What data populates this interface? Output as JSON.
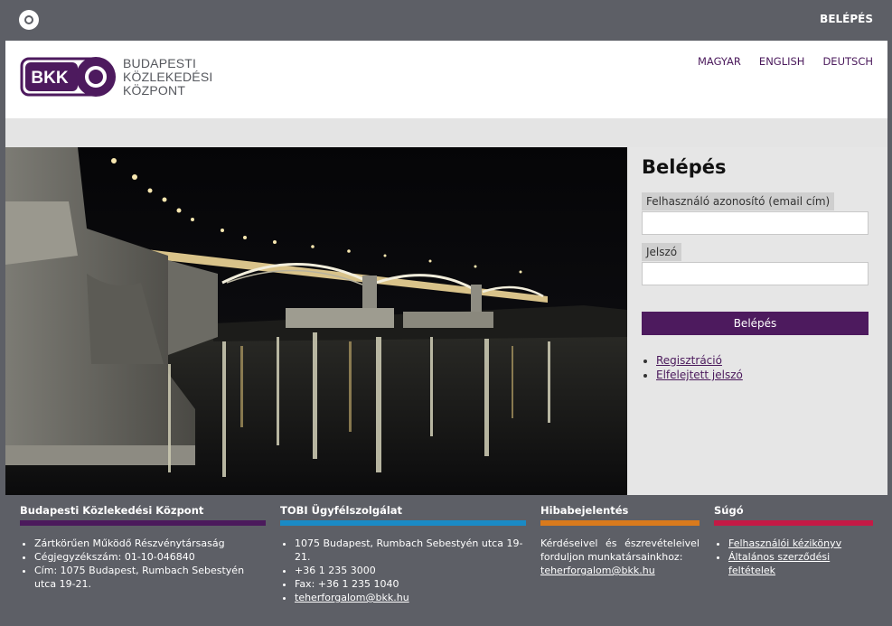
{
  "topbar": {
    "login_label": "BELÉPÉS"
  },
  "header": {
    "logo_text": "BKK",
    "org_name_lines": [
      "BUDAPESTI",
      "KÖZLEKEDÉSI",
      "KÖZPONT"
    ],
    "languages": [
      "MAGYAR",
      "ENGLISH",
      "DEUTSCH"
    ]
  },
  "login": {
    "title": "Belépés",
    "username_label": "Felhasználó azonosító (email cím)",
    "username_value": "",
    "password_label": "Jelszó",
    "password_value": "",
    "submit_label": "Belépés",
    "links": [
      "Regisztráció",
      "Elfelejtett jelszó"
    ]
  },
  "footer": {
    "col1": {
      "title": "Budapesti Közlekedési Központ",
      "bar_color": "#4b1a5c",
      "items": [
        "Zártkörűen Működő Részvénytársaság",
        "Cégjegyzékszám: 01-10-046840",
        "Cím: 1075 Budapest, Rumbach Sebestyén utca 19-21."
      ]
    },
    "col2": {
      "title": "TOBI Ügyfélszolgálat",
      "bar_color": "#1a8ac5",
      "items": [
        "1075 Budapest, Rumbach Sebestyén utca 19-21.",
        "+36 1 235 3000",
        "Fax: +36 1 235 1040"
      ],
      "email": "teherforgalom@bkk.hu"
    },
    "col3": {
      "title": "Hibabejelentés",
      "bar_color": "#d97a1c",
      "text": "Kérdéseivel és észrevételeivel forduljon munkatársainkhoz:",
      "email": "teherforgalom@bkk.hu"
    },
    "col4": {
      "title": "Súgó",
      "bar_color": "#c41a45",
      "links": [
        "Felhasználói kézikönyv",
        "Általános szerződési feltételek"
      ]
    }
  },
  "colors": {
    "brand": "#4d1a5e",
    "header_bg": "#5d5f66"
  }
}
